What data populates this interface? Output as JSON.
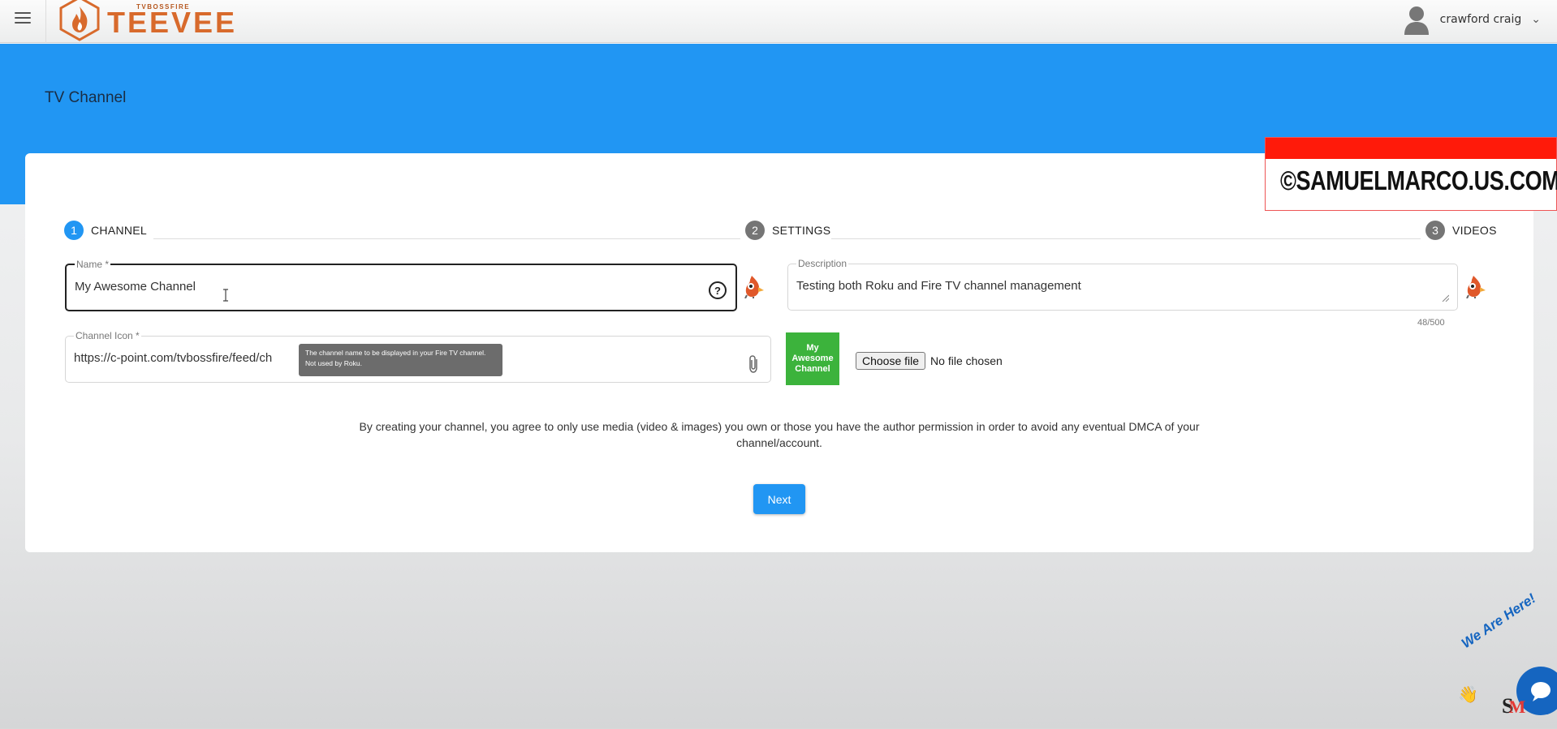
{
  "topbar": {
    "logo_small": "TVBOSSFIRE",
    "logo_big": "TEEVEE",
    "user_name": "crawford craig"
  },
  "page": {
    "title": "TV Channel"
  },
  "stepper": {
    "steps": [
      {
        "number": "1",
        "label": "CHANNEL"
      },
      {
        "number": "2",
        "label": "SETTINGS"
      },
      {
        "number": "3",
        "label": "VIDEOS"
      }
    ]
  },
  "form": {
    "name": {
      "label": "Name *",
      "value": "My Awesome Channel"
    },
    "description": {
      "label": "Description",
      "value": "Testing both Roku and Fire TV channel management",
      "counter": "48/500"
    },
    "channel_icon": {
      "label": "Channel Icon *",
      "value": "https://c-point.com/tvbossfire/feed/ch"
    },
    "tooltip": "The channel name to be displayed in your Fire TV channel. Not used by Roku.",
    "icon_preview_text": "My Awesome Channel",
    "choose_file_label": "Choose file",
    "no_file_text": "No file chosen",
    "disclaimer": "By creating your channel, you agree to only use media (video & images) you own or those you have the author permission in order to avoid any eventual DMCA of your channel/account.",
    "next_label": "Next"
  },
  "watermark": {
    "text": "©SAMUELMARCO.US.COM"
  },
  "chat_widget": {
    "text": "We Are Here!",
    "logo_s": "S",
    "logo_m": "M"
  },
  "colors": {
    "primary": "#2196f3",
    "step_idle": "#757575",
    "logo_orange": "#d86a2c",
    "preview_green": "#3cb33c",
    "watermark_red": "#ff1a0a"
  }
}
